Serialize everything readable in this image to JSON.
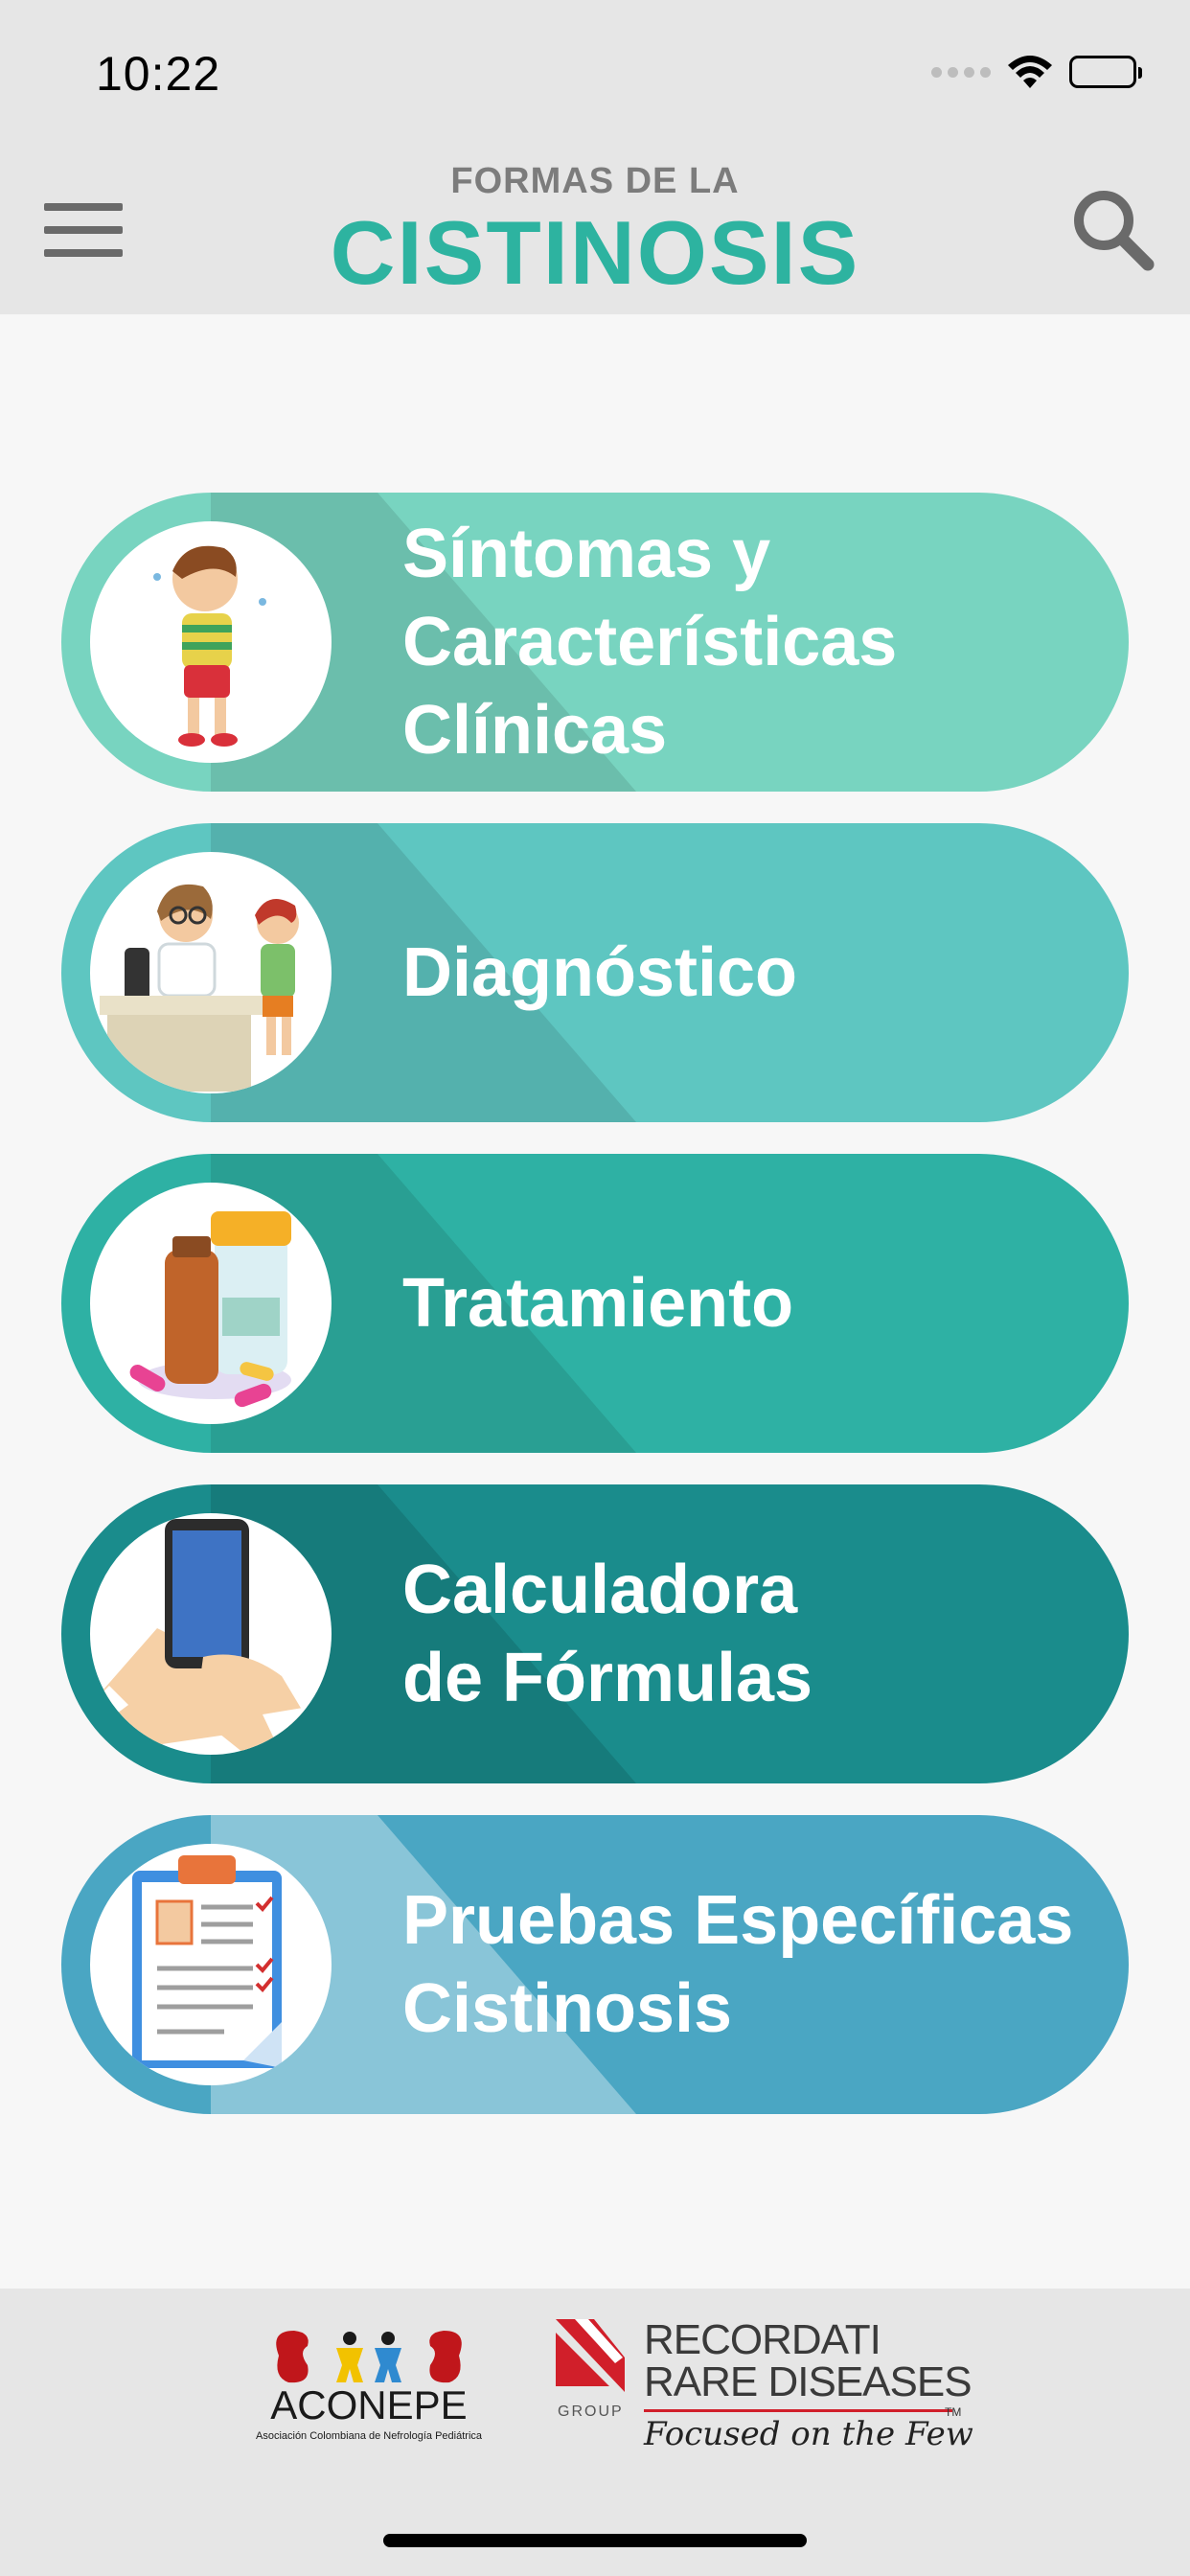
{
  "status_bar": {
    "time": "10:22"
  },
  "header": {
    "subtitle": "FORMAS DE LA",
    "title": "CISTINOSIS",
    "accent_color": "#2db3a0"
  },
  "menu": [
    {
      "label": "Síntomas y\nCaracterísticas\nClínicas",
      "icon": "sick-child-icon",
      "color": "#78d4c0"
    },
    {
      "label": "Diagnóstico",
      "icon": "doctor-patient-icon",
      "color": "#5ec6c1"
    },
    {
      "label": "Tratamiento",
      "icon": "medicine-bottles-icon",
      "color": "#2eb1a4"
    },
    {
      "label": "Calculadora\nde Fórmulas",
      "icon": "phone-hand-icon",
      "color": "#1a8c8c"
    },
    {
      "label": "Pruebas Específicas\nCistinosis",
      "icon": "clipboard-icon",
      "color": "#4aa6c3"
    }
  ],
  "footer": {
    "aconepe_name": "ACONEPE",
    "aconepe_subtitle": "Asociación Colombiana de Nefrología Pediátrica",
    "recordati_line1": "RECORDATI",
    "recordati_line2": "RARE DISEASES",
    "recordati_group": "GROUP",
    "recordati_tagline": "Focused on the Few",
    "trademark": "TM"
  }
}
